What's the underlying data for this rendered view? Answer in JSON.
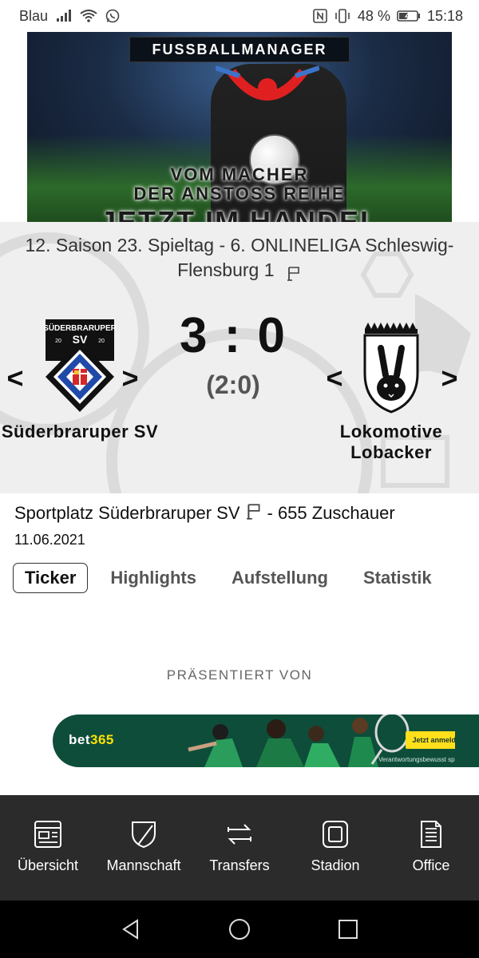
{
  "status_bar": {
    "carrier": "Blau",
    "battery": "48 %",
    "time": "15:18",
    "icons": [
      "signal-icon",
      "wifi-icon",
      "whatsapp-icon",
      "nfc-icon",
      "vibrate-icon",
      "battery-icon"
    ]
  },
  "ad_top": {
    "brand": "FUSSBALLMANAGER",
    "line1": "VOM MACHER",
    "line2": "DER ANSTOSS REIHE",
    "line3": "JETZT IM HANDEL"
  },
  "match": {
    "league": "12. Saison 23. Spieltag - 6. ONLINELIGA Schleswig-Flensburg 1",
    "score": "3 : 0",
    "halftime": "(2:0)",
    "home": {
      "name": "Süderbraruper SV",
      "crest_title": "SÜDERBRARUPER",
      "crest_sv": "SV",
      "crest_year_left": "20",
      "crest_year_right": "20"
    },
    "away": {
      "name": "Lokomotive Lobacker"
    },
    "prev_arrow": "<",
    "next_arrow": ">"
  },
  "venue": {
    "place": "Sportplatz Süderbraruper SV",
    "spectators": "- 655 Zuschauer",
    "date": "11.06.2021"
  },
  "tabs": [
    {
      "label": "Ticker",
      "active": true
    },
    {
      "label": "Highlights",
      "active": false
    },
    {
      "label": "Aufstellung",
      "active": false
    },
    {
      "label": "Statistik",
      "active": false
    }
  ],
  "presented_by": "PRÄSENTIERT VON",
  "ad_bet": {
    "brand_left": "bet",
    "brand_right": "365",
    "cta": "Jetzt anmelden",
    "disclaimer": "Verantwortungsbewusst spielen 18+"
  },
  "bottom_nav": [
    {
      "label": "Übersicht",
      "icon": "overview-icon"
    },
    {
      "label": "Mannschaft",
      "icon": "shield-icon"
    },
    {
      "label": "Transfers",
      "icon": "transfer-arrows-icon"
    },
    {
      "label": "Stadion",
      "icon": "stadium-icon"
    },
    {
      "label": "Office",
      "icon": "document-icon"
    }
  ],
  "colors": {
    "match_bg": "#efefef",
    "nav_bg": "#2b2b2b",
    "bet_green": "#0e4d3a",
    "bet_yellow": "#ffdf1b",
    "crest_blue": "#1f4aa8"
  }
}
